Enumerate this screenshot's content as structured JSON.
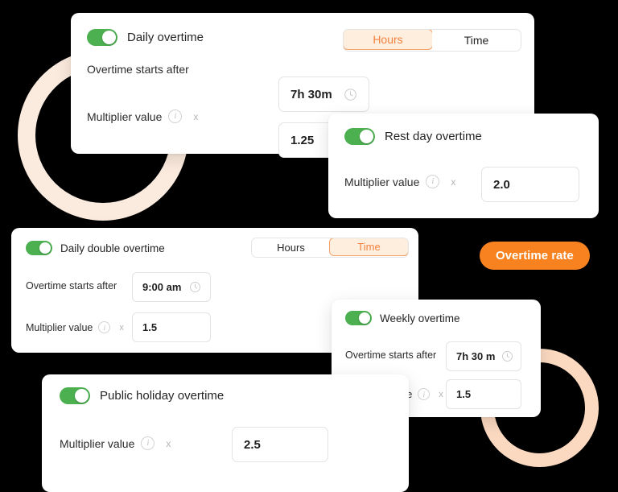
{
  "theme": {
    "background": "#000000",
    "card_bg": "#ffffff",
    "toggle_on": "#4caf50",
    "accent_orange": "#f7821f",
    "segment_active_bg": "#fdeede",
    "segment_active_text": "#f5803e",
    "segment_active_border": "#f6a26a",
    "ring_left": "#fbeade",
    "ring_right": "#fbd9c0",
    "input_border": "#e3e3e3",
    "text_primary": "#252525",
    "muted": "#b4b4b4"
  },
  "badge": {
    "label": "Overtime rate"
  },
  "decor": {
    "ring_left_name": "decorative-ring-left",
    "ring_right_name": "decorative-ring-right"
  },
  "cards": {
    "daily": {
      "title": "Daily overtime",
      "toggle_state": "on",
      "segment": {
        "options": [
          "Hours",
          "Time"
        ],
        "selected": "Hours"
      },
      "fields": [
        {
          "label": "Overtime starts after",
          "value": "7h 30m",
          "icon": "clock-icon",
          "has_info": false,
          "has_multiply": false
        },
        {
          "label": "Multiplier value",
          "value": "1.25",
          "icon": "none",
          "has_info": true,
          "has_multiply": true,
          "multiply_sign": "x"
        }
      ]
    },
    "restday": {
      "title": "Rest day overtime",
      "toggle_state": "on",
      "fields": [
        {
          "label": "Multiplier value",
          "value": "2.0",
          "icon": "none",
          "has_info": true,
          "has_multiply": true,
          "multiply_sign": "x"
        }
      ]
    },
    "daily_double": {
      "title": "Daily double overtime",
      "toggle_state": "on",
      "segment": {
        "options": [
          "Hours",
          "Time"
        ],
        "selected": "Time"
      },
      "fields": [
        {
          "label": "Overtime starts after",
          "value": "9:00 am",
          "icon": "clock-icon",
          "has_info": false,
          "has_multiply": false
        },
        {
          "label": "Multiplier value",
          "value": "1.5",
          "icon": "none",
          "has_info": true,
          "has_multiply": true,
          "multiply_sign": "x"
        }
      ]
    },
    "weekly": {
      "title": "Weekly overtime",
      "toggle_state": "on",
      "fields": [
        {
          "label": "Overtime starts after",
          "value": "7h 30 m",
          "icon": "clock-icon",
          "has_info": false,
          "has_multiply": false
        },
        {
          "label": "Multiplier value",
          "value": "1.5",
          "icon": "none",
          "has_info": true,
          "has_multiply": true,
          "multiply_sign": "x"
        }
      ]
    },
    "public_holiday": {
      "title": "Public holiday overtime",
      "toggle_state": "on",
      "fields": [
        {
          "label": "Multiplier value",
          "value": "2.5",
          "icon": "none",
          "has_info": true,
          "has_multiply": true,
          "multiply_sign": "x"
        }
      ]
    }
  },
  "icons": {
    "info": "i",
    "clock": "clock-icon"
  }
}
